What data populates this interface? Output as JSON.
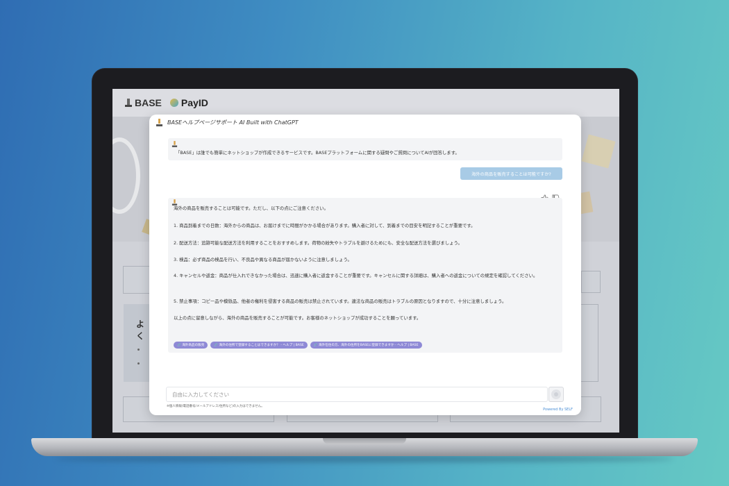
{
  "site": {
    "logo_base": "BASE",
    "logo_payid": "PayID",
    "side_heading": "よく"
  },
  "modal": {
    "title": "BASEヘルプページサポート AI Built with ChatGPT",
    "intro_message": "「BASE」は誰でも簡単にネットショップが作成できるサービスです。BASEプラットフォームに関する疑問やご質問についてAIが回答します。",
    "user_message": "海外の商品を販売することは可能ですか?",
    "answer": {
      "paragraphs": [
        "海外の商品を販売することは可能です。ただし、以下の点にご注意ください。",
        "1. 商品到着までの日数：海外からの商品は、お届けまでに時間がかかる場合があります。購入者に対して、到着までの目安を明記することが重要です。",
        "2. 配送方法：追跡可能な配送方法を利用することをおすすめします。荷物の紛失やトラブルを避けるためにも、安全な配送方法を選びましょう。",
        "3. 検品：必ず商品の検品を行い、不良品や異なる商品が届かないように注意しましょう。",
        "4. キャンセルや返金：商品が仕入れできなかった場合は、迅速に購入者に返金することが重要です。キャンセルに関する詳細は、購入者への返金についての規定を確認してください。",
        "5. 禁止事項：コピー品や模倣品、他者の権利を侵害する商品の販売は禁止されています。違法な商品の販売はトラブルの原因となりますので、十分に注意しましょう。",
        "以上の点に留意しながら、海外の商品を販売することが可能です。お客様のネットショップが成功することを願っています。"
      ],
      "links": [
        "海外商品の販売",
        "海外の住所で登録することはできますか？ - ヘルプ | BASE",
        "海外在住の方、海外の住所をBASEに登録できますか - ヘルプ | BASE"
      ]
    },
    "input_placeholder": "自由に入力してください",
    "input_notice": "※個人情報(電話番号/メールアドレス/住所など)の入力はできません。",
    "powered_by": "Powered By SELF",
    "icons": {
      "thumb_up": "thumb-up-icon",
      "thumb_down": "thumb-down-icon",
      "send": "send-icon",
      "link": "link-icon"
    }
  }
}
